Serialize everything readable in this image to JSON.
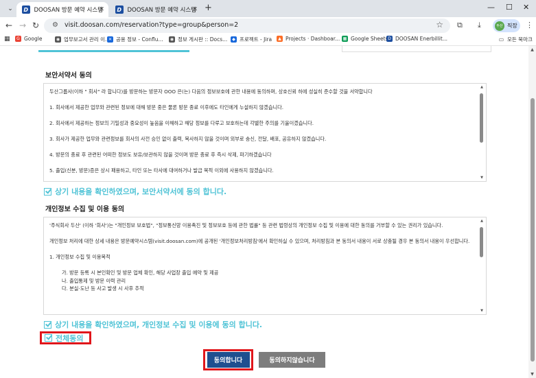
{
  "browser": {
    "tabs": [
      {
        "title": "DOOSAN 방문 예약 시스템",
        "active": true
      },
      {
        "title": "DOOSAN 방문 예약 시스템",
        "active": false
      }
    ],
    "new_tab": "+",
    "url": "visit.doosan.com/reservation?type=group&person=2",
    "profile_name": "직장",
    "profile_avatar": "두산",
    "bookmarks": [
      {
        "label": "Google",
        "color": "#ea4335",
        "glyph": "G"
      },
      {
        "label": "업무보고서 관리 이...",
        "color": "#555555",
        "glyph": "◉"
      },
      {
        "label": "공용 정보 - Conflu...",
        "color": "#1868db",
        "glyph": "✕"
      },
      {
        "label": "정보 게시판 :: Docs...",
        "color": "#555555",
        "glyph": "◉"
      },
      {
        "label": "프로젝트 - Jira",
        "color": "#1868db",
        "glyph": "◆"
      },
      {
        "label": "Projects · Dashboar...",
        "color": "#fc6d26",
        "glyph": "▲"
      },
      {
        "label": "Google Sheets",
        "color": "#0f9d58",
        "glyph": "▦"
      },
      {
        "label": "DOOSAN Enerbillit...",
        "color": "#1d4fa0",
        "glyph": "D"
      }
    ],
    "all_bookmarks": "모든 북마크"
  },
  "security": {
    "title": "보안서약서 동의",
    "paragraphs": [
      "두산그룹사(이하 \" 회사\" 라 합니다)를 방문하는 방문자 OOO 은(는) 다음의 정보보호에 관한 내용에 동의하며, 상호신뢰 하에 성실히 준수할 것을 서약합니다",
      "1. 회사에서 제공한 업무와 관련된 정보에 대해 방문 중은 물론 방문 종료 이후에도 타인에게 누설하지 않겠습니다.",
      "2. 회사에서 제공하는 정보의 기밀성과 중요성이 높음을 이해하고 해당 정보를 다루고 보호하는데 각별한 주의를 기울이겠습니다.",
      "3. 회사가 제공한 업무와 관련정보를 회사의 사전 승인 없이 출력, 복사하지 않을 것이며 외부로 송신, 전달, 배포, 공유하지 않겠습니다.",
      "4. 방문의 종료 후 관련된 어떠한 정보도 보유/보관하지 않을 것이며 방문 종료 후 즉시 삭제, 파기하겠습니다",
      "5. 출입(신분, 방문)증은 상시 패용하고, 타인 또는 타사에 대여하거나 발급 목적 이외에 사용하지 않겠습니다."
    ],
    "confirm": "상기 내용을 확인하였으며, 보안서약서에 동의 합니다."
  },
  "privacy": {
    "title": "개인정보 수집 및 이용 동의",
    "paragraphs": [
      "'주식회사 두산' (이하 '회사')는 \"개인정보 보호법\", \"정보통신망 이용촉진 및 정보보호 등에 관한 법률\" 등 관련 법령상의 개인정보 수집 및 이용에 대한 동의를 거부할 수 있는 권리가 있습니다.",
      "개인정보 처리에 대한 상세 내용은 방문예약시스템(visit.doosan.com)에 공개된 '개인정보처리방침'에서 확인하실 수 있으며, 처리방침과 본 동의서 내용이 서로 상충될 경우 본 동의서 내용이 우선합니다.",
      "1. 개인정보 수집 및 이용목적"
    ],
    "purposes": [
      "가. 방문 등록 시 본인확인 및 방문 업체 확인, 해당 사업장 출입 예약 및 제공",
      "나. 출입통제 및 방문 이력 관리",
      "다. 분실·도난 등 사고 발생 시 사후 추적"
    ],
    "confirm": "상기 내용을 확인하였으며, 개인정보 수집 및 이용에 동의 합니다."
  },
  "all_agree": "전체동의",
  "buttons": {
    "agree": "동의합니다",
    "disagree": "동의하지않습니다"
  }
}
